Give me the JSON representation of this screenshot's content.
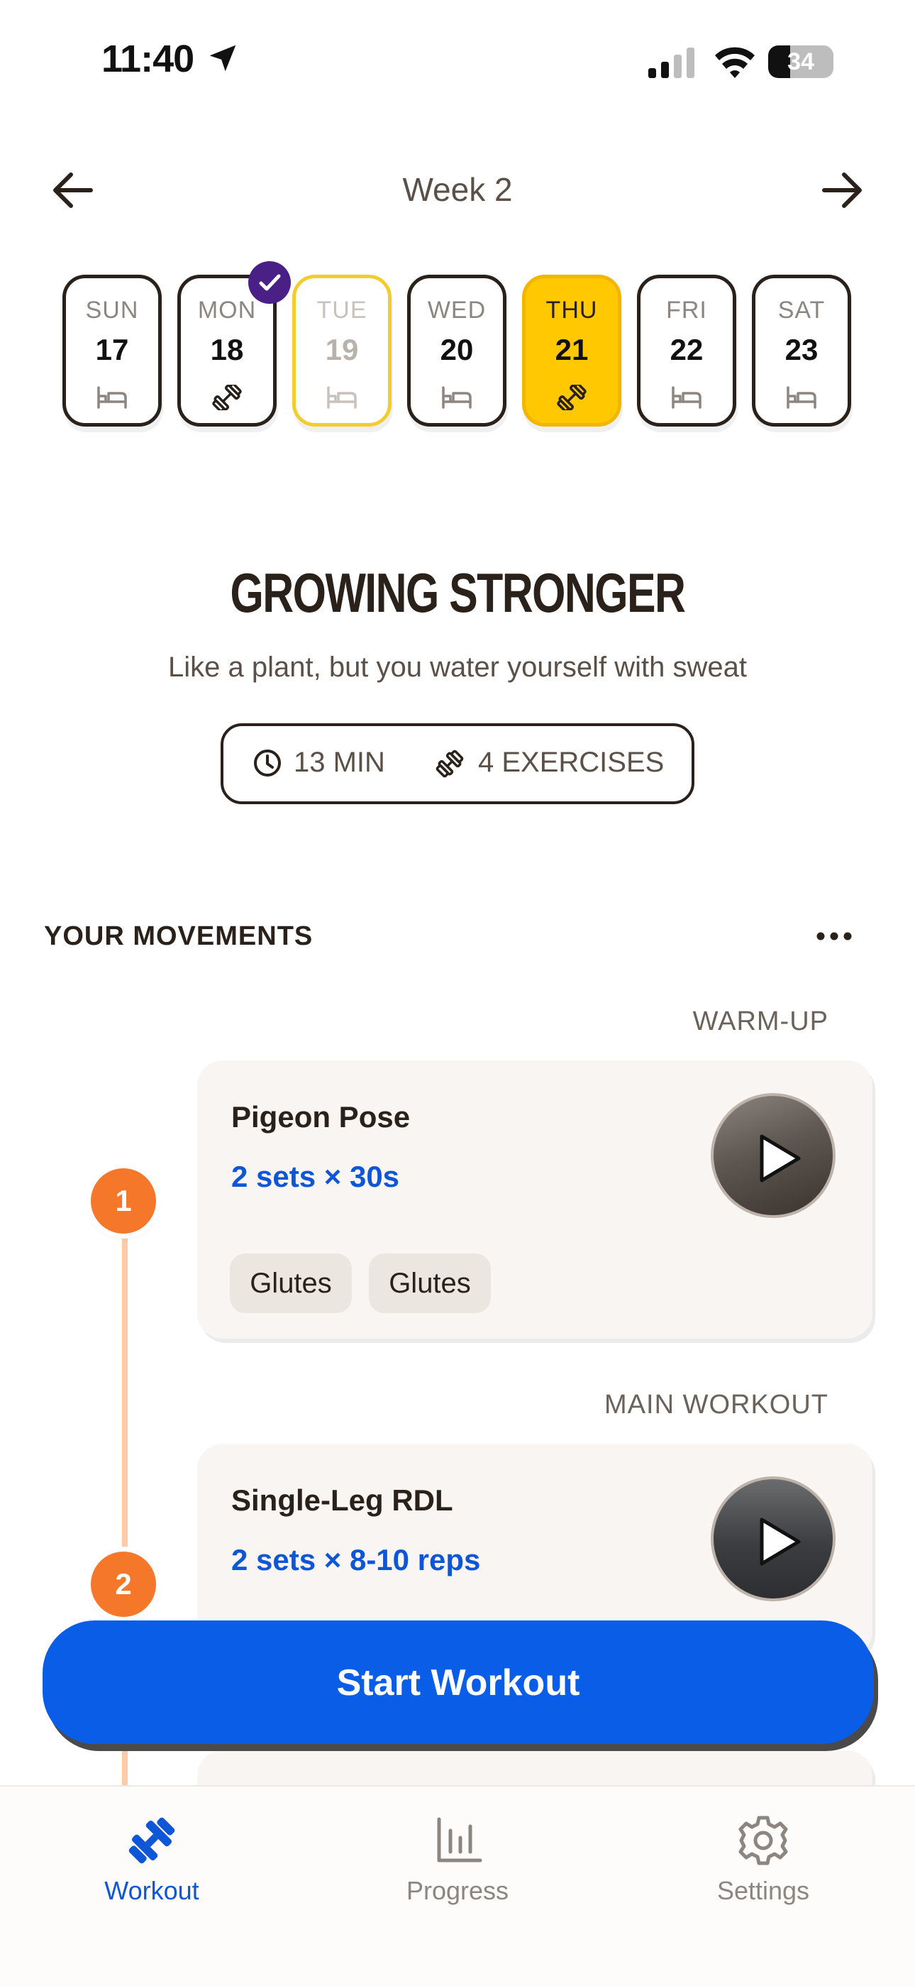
{
  "status_bar": {
    "time": "11:40",
    "battery": "34",
    "battery_level": 0.34
  },
  "header": {
    "week_title": "Week 2"
  },
  "days": [
    {
      "name": "SUN",
      "num": "17",
      "type": "rest"
    },
    {
      "name": "MON",
      "num": "18",
      "type": "workout",
      "completed": true
    },
    {
      "name": "TUE",
      "num": "19",
      "type": "rest",
      "state": "today"
    },
    {
      "name": "WED",
      "num": "20",
      "type": "rest"
    },
    {
      "name": "THU",
      "num": "21",
      "type": "workout",
      "state": "selected"
    },
    {
      "name": "FRI",
      "num": "22",
      "type": "rest"
    },
    {
      "name": "SAT",
      "num": "23",
      "type": "rest"
    }
  ],
  "workout": {
    "title": "GROWING STRONGER",
    "subtitle": "Like a plant, but you water yourself with sweat",
    "duration": "13 MIN",
    "exercise_count": "4 EXERCISES"
  },
  "movements": {
    "section_title": "YOUR MOVEMENTS",
    "groups": [
      {
        "label": "WARM-UP",
        "exercises": [
          {
            "step": "1",
            "name": "Pigeon Pose",
            "sets": "2 sets × 30s",
            "tags": [
              "Glutes",
              "Glutes"
            ]
          }
        ]
      },
      {
        "label": "MAIN WORKOUT",
        "exercises": [
          {
            "step": "2",
            "name": "Single-Leg RDL",
            "sets": "2 sets × 8-10 reps"
          }
        ]
      }
    ]
  },
  "start_button": {
    "label": "Start Workout"
  },
  "tabs": [
    {
      "label": "Workout",
      "icon": "dumbbell-icon",
      "active": true
    },
    {
      "label": "Progress",
      "icon": "bar-chart-icon"
    },
    {
      "label": "Settings",
      "icon": "gear-icon"
    }
  ],
  "colors": {
    "accent_blue": "#0a5de6",
    "selected_day": "#ffc800",
    "step_orange": "#f5772a",
    "check_purple": "#4a1f86"
  }
}
